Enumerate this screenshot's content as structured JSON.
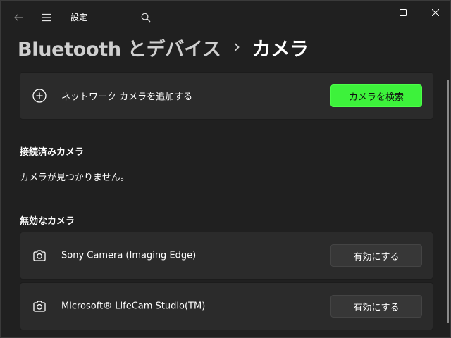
{
  "window": {
    "title": "設定"
  },
  "breadcrumb": {
    "parent": "Bluetooth とデバイス",
    "separator": "›",
    "current": "カメラ"
  },
  "add_network_camera": {
    "label": "ネットワーク カメラを追加する",
    "button_label": "カメラを検索",
    "icon": "plus-circle-icon"
  },
  "connected_cameras": {
    "heading": "接続済みカメラ",
    "empty_message": "カメラが見つかりません。"
  },
  "disabled_cameras": {
    "heading": "無効なカメラ",
    "items": [
      {
        "name": "Sony Camera (Imaging Edge)",
        "button_label": "有効にする",
        "icon": "camera-icon"
      },
      {
        "name": "Microsoft® LifeCam Studio(TM)",
        "button_label": "有効にする",
        "icon": "camera-icon"
      }
    ]
  },
  "colors": {
    "accent": "#3df23b",
    "background": "#202020",
    "card": "#2b2b2b"
  }
}
